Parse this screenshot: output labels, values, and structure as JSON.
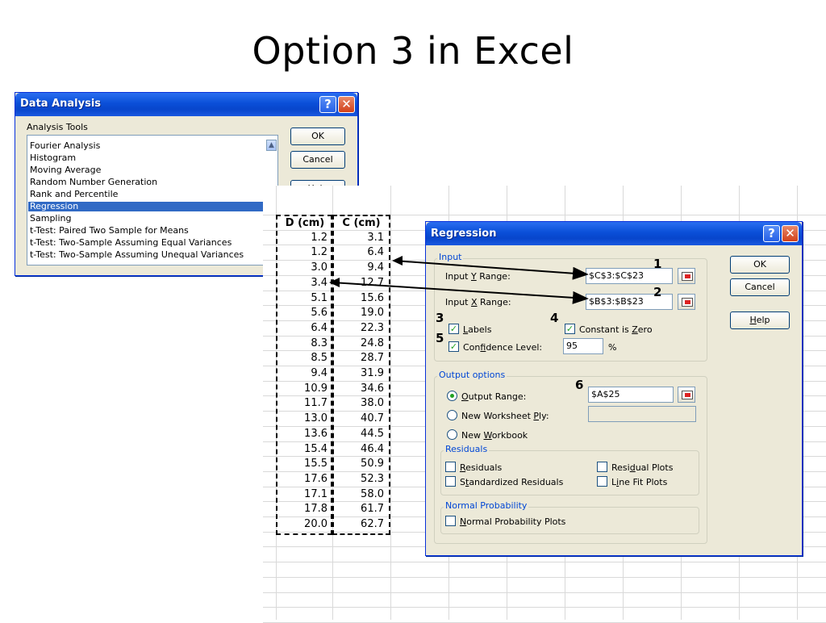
{
  "slide": {
    "title": "Option 3 in Excel"
  },
  "data_analysis": {
    "title": "Data Analysis",
    "help_glyph": "?",
    "close_glyph": "✕",
    "tools_label": "Analysis Tools",
    "tools": [
      "Fourier Analysis",
      "Histogram",
      "Moving Average",
      "Random Number Generation",
      "Rank and Percentile",
      "Regression",
      "Sampling",
      "t-Test: Paired Two Sample for Means",
      "t-Test: Two-Sample Assuming Equal Variances",
      "t-Test: Two-Sample Assuming Unequal Variances"
    ],
    "selected_tool": "Regression",
    "ok": "OK",
    "cancel": "Cancel",
    "help": "Help"
  },
  "sheet": {
    "headers": [
      "D (cm)",
      "C (cm)"
    ],
    "d": [
      "1.2",
      "1.2",
      "3.0",
      "3.4",
      "5.1",
      "5.6",
      "6.4",
      "8.3",
      "8.5",
      "9.4",
      "10.9",
      "11.7",
      "13.0",
      "13.6",
      "15.4",
      "15.5",
      "17.6",
      "17.1",
      "17.8",
      "20.0"
    ],
    "c": [
      "3.1",
      "6.4",
      "9.4",
      "12.7",
      "15.6",
      "19.0",
      "22.3",
      "24.8",
      "28.7",
      "31.9",
      "34.6",
      "38.0",
      "40.7",
      "44.5",
      "46.4",
      "50.9",
      "52.3",
      "58.0",
      "61.7",
      "62.7"
    ]
  },
  "regression": {
    "title": "Regression",
    "help_glyph": "?",
    "close_glyph": "✕",
    "input_frame": "Input",
    "input_y_label": "Input Y Range:",
    "input_y_value": "$C$3:$C$23",
    "input_x_label": "Input X Range:",
    "input_x_value": "$B$3:$B$23",
    "labels": "Labels",
    "labels_checked": true,
    "constant_zero": "Constant is Zero",
    "constant_zero_checked": true,
    "confidence": "Confidence Level:",
    "confidence_checked": true,
    "confidence_value": "95",
    "percent": "%",
    "output_frame": "Output options",
    "output_range": "Output Range:",
    "output_range_value": "$A$25",
    "new_ply": "New Worksheet Ply:",
    "new_workbook": "New Workbook",
    "residuals_frame": "Residuals",
    "residuals": "Residuals",
    "std_residuals": "Standardized Residuals",
    "residual_plots": "Residual Plots",
    "line_fit_plots": "Line Fit Plots",
    "normal_frame": "Normal Probability",
    "normal_plots": "Normal Probability Plots",
    "ok": "OK",
    "cancel": "Cancel",
    "help": "Help"
  },
  "annotations": [
    "1",
    "2",
    "3",
    "4",
    "5",
    "6"
  ],
  "colors": {
    "titlebar": "#0a4fd8",
    "selection": "#316ac5",
    "dialog_bg": "#ece9d8",
    "frame_title": "#0046d5"
  }
}
